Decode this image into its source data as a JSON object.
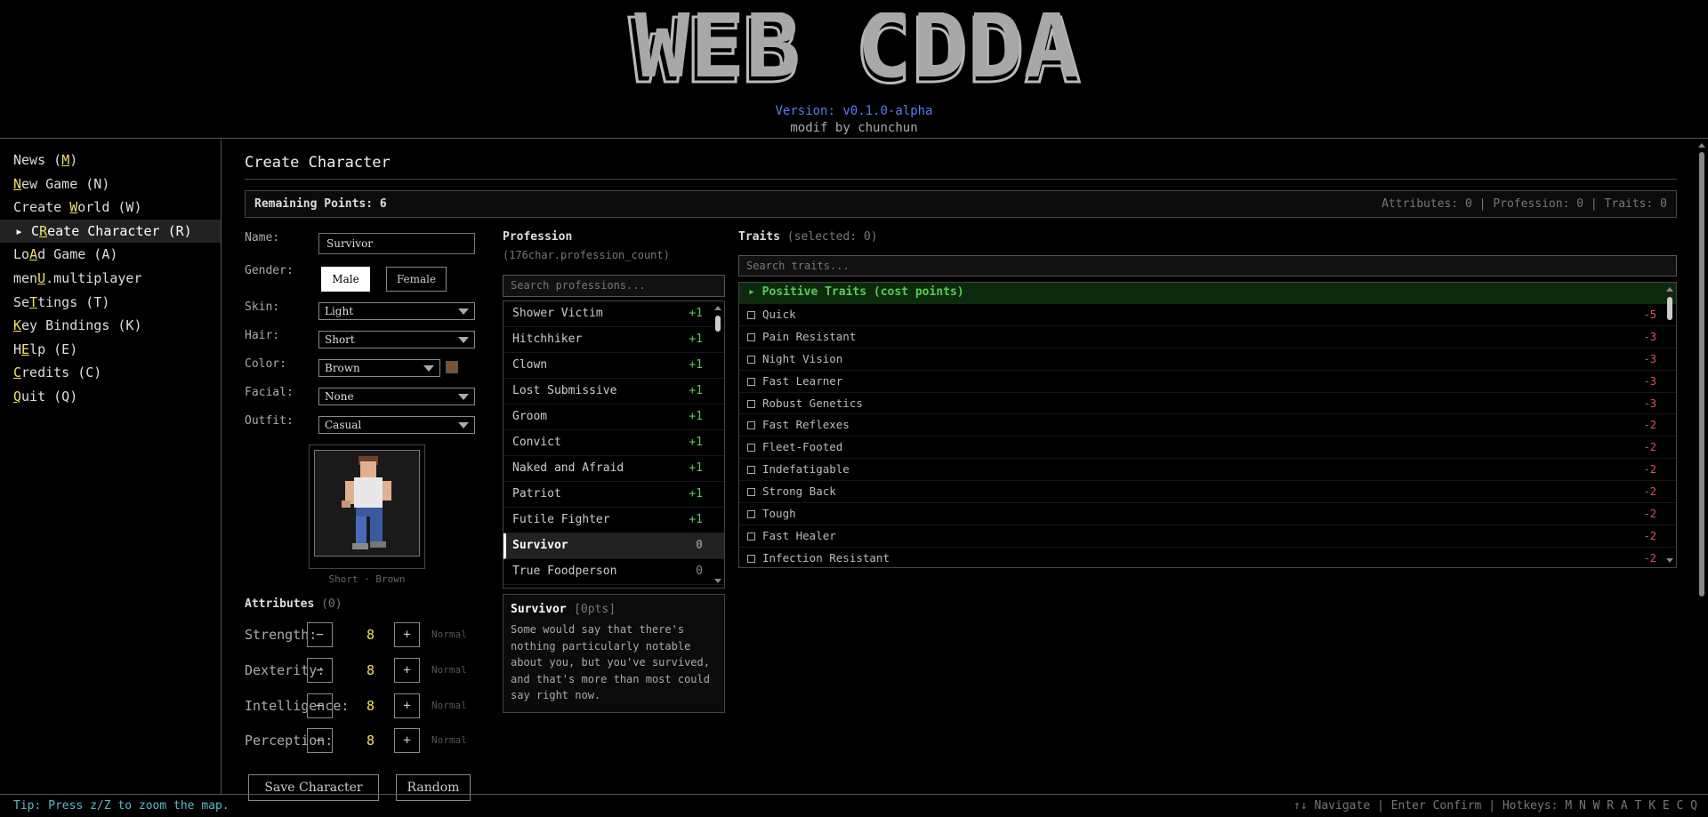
{
  "header": {
    "logo_text": "WEB CDDA",
    "version": "Version: v0.1.0-alpha",
    "modif": "modif by chunchun"
  },
  "sidebar": {
    "items": [
      {
        "pre": "News (",
        "key": "M",
        "post": ")"
      },
      {
        "pre": "",
        "key": "N",
        "post": "ew Game (N)"
      },
      {
        "pre": "Create ",
        "key": "W",
        "post": "orld (W)"
      },
      {
        "pre": "▸ C",
        "key": "R",
        "post": "eate Character (R)"
      },
      {
        "pre": "Lo",
        "key": "A",
        "post": "d Game (A)"
      },
      {
        "pre": "men",
        "key": "U",
        "post": ".multiplayer"
      },
      {
        "pre": "Se",
        "key": "T",
        "post": "tings (T)"
      },
      {
        "pre": "",
        "key": "K",
        "post": "ey Bindings (K)"
      },
      {
        "pre": "H",
        "key": "E",
        "post": "lp (E)"
      },
      {
        "pre": "",
        "key": "C",
        "post": "redits (C)"
      },
      {
        "pre": "",
        "key": "Q",
        "post": "uit (Q)"
      }
    ]
  },
  "main": {
    "title": "Create Character",
    "remaining": "Remaining Points: 6",
    "summary": "Attributes: 0 | Profession: 0 | Traits: 0"
  },
  "form": {
    "name_label": "Name:",
    "name_value": "Survivor",
    "gender_label": "Gender:",
    "gender_male": "Male",
    "gender_female": "Female",
    "skin_label": "Skin:",
    "skin_value": "Light",
    "hair_label": "Hair:",
    "hair_value": "Short",
    "color_label": "Color:",
    "color_value": "Brown",
    "color_swatch": "#7a5232",
    "facial_label": "Facial:",
    "facial_value": "None",
    "outfit_label": "Outfit:",
    "outfit_value": "Casual",
    "preview_caption": "Short · Brown"
  },
  "attributes": {
    "title": "Attributes",
    "sub": "(0)",
    "minus": "−",
    "plus": "+",
    "items": [
      {
        "name": "Strength:",
        "value": "8",
        "level": "Normal"
      },
      {
        "name": "Dexterity:",
        "value": "8",
        "level": "Normal"
      },
      {
        "name": "Intelligence:",
        "value": "8",
        "level": "Normal"
      },
      {
        "name": "Perception:",
        "value": "8",
        "level": "Normal"
      }
    ]
  },
  "actions": {
    "save": "Save Character",
    "random": "Random"
  },
  "profession": {
    "title": "Profession",
    "count": "(176char.profession_count)",
    "search_placeholder": "Search professions...",
    "items": [
      {
        "name": "Shower Victim",
        "cost": "+1"
      },
      {
        "name": "Hitchhiker",
        "cost": "+1"
      },
      {
        "name": "Clown",
        "cost": "+1"
      },
      {
        "name": "Lost Submissive",
        "cost": "+1"
      },
      {
        "name": "Groom",
        "cost": "+1"
      },
      {
        "name": "Convict",
        "cost": "+1"
      },
      {
        "name": "Naked and Afraid",
        "cost": "+1"
      },
      {
        "name": "Patriot",
        "cost": "+1"
      },
      {
        "name": "Futile Fighter",
        "cost": "+1"
      },
      {
        "name": "Survivor",
        "cost": "0",
        "selected": true
      },
      {
        "name": "True Foodperson",
        "cost": "0"
      }
    ],
    "selected_name": "Survivor",
    "selected_pts": "[0pts]",
    "selected_desc": "Some would say that there's nothing particularly notable about you, but you've survived, and that's more than most could say right now."
  },
  "traits": {
    "title": "Traits",
    "sub": "(selected: 0)",
    "search_placeholder": "Search traits...",
    "group": "▸ Positive Traits (cost points)",
    "items": [
      {
        "name": "Quick",
        "cost": "-5"
      },
      {
        "name": "Pain Resistant",
        "cost": "-3"
      },
      {
        "name": "Night Vision",
        "cost": "-3"
      },
      {
        "name": "Fast Learner",
        "cost": "-3"
      },
      {
        "name": "Robust Genetics",
        "cost": "-3"
      },
      {
        "name": "Fast Reflexes",
        "cost": "-2"
      },
      {
        "name": "Fleet-Footed",
        "cost": "-2"
      },
      {
        "name": "Indefatigable",
        "cost": "-2"
      },
      {
        "name": "Strong Back",
        "cost": "-2"
      },
      {
        "name": "Tough",
        "cost": "-2"
      },
      {
        "name": "Fast Healer",
        "cost": "-2"
      },
      {
        "name": "Infection Resistant",
        "cost": "-2"
      }
    ]
  },
  "footer": {
    "tip": "Tip: Press z/Z to zoom the map.",
    "hints": "↑↓ Navigate | Enter Confirm | Hotkeys: M N W R A T K E C Q"
  }
}
